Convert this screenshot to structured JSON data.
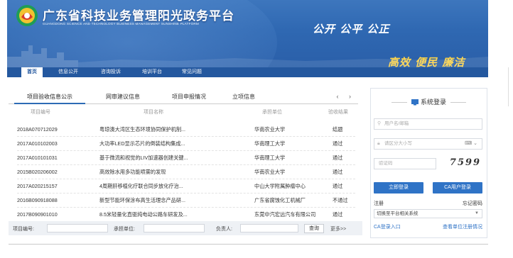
{
  "header": {
    "title": "广东省科技业务管理阳光政务平台",
    "subtitle": "GUANGDONG SCIENCE AND TECHNOLOGY BUSINESS MANAGEMENT SUNSHINE PLATFORM",
    "slogan1": "公开 公平 公正",
    "slogan2": "高效 便民 廉洁"
  },
  "nav": {
    "items": [
      {
        "label": "首页"
      },
      {
        "label": "信息公开"
      },
      {
        "label": "咨询投诉"
      },
      {
        "label": "培训平台"
      },
      {
        "label": "常见问题"
      }
    ]
  },
  "tabs": {
    "items": [
      {
        "label": "项目验收信息公示"
      },
      {
        "label": "网审建议信息"
      },
      {
        "label": "项目申报情况"
      },
      {
        "label": "立项信息"
      }
    ],
    "arrows": "‹ ›"
  },
  "table": {
    "headers": [
      "项目编号",
      "项目名称",
      "承担单位",
      "验收结果"
    ],
    "rows": [
      [
        "2018A070712029",
        "粤琼澳大湾区生态环境协同保护机制...",
        "华南农业大学",
        "结题"
      ],
      [
        "2017A010102003",
        "大功率LED显示芯片的倒装结构集成...",
        "华南理工大学",
        "通过"
      ],
      [
        "2017A010101031",
        "基于微流和视觉的LIV加速器创建关键...",
        "华南理工大学",
        "通过"
      ],
      [
        "2015B020206002",
        "高效除水用多功能喷雾的发现",
        "华南农业大学",
        "通过"
      ],
      [
        "2017A020215157",
        "4周期肝移植化疗联合同步放化疗治...",
        "中山大学附属肿瘤中心",
        "通过"
      ],
      [
        "2016B090918088",
        "新型节能环保涂布高生活理念产品研...",
        "广东省腐蚀化工机械厂",
        "不通过"
      ],
      [
        "2017B090901010",
        "8.5米轻量化直驱纯电动公路车研发及...",
        "东莞中汽宏远汽车有限公司",
        "通过"
      ]
    ]
  },
  "search": {
    "project_no_label": "项目编号:",
    "unit_label": "承担单位:",
    "person_label": "负责人:",
    "search_button": "查询",
    "more_link": "更多>>"
  },
  "login": {
    "heading": "系统登录",
    "username_placeholder": "用户名/邮箱",
    "password_placeholder": "请区分大小写",
    "captcha_placeholder": "验证码",
    "captcha_text": "7599",
    "login_button": "立即登录",
    "ca_button": "CA用户登录",
    "register_link": "注册",
    "forgot_link": "忘记密码",
    "switch_select": "切换至平台相关系统",
    "ca_entry_link": "CA登录入口",
    "unit_query_link": "查看单位注册情况"
  },
  "colors": {
    "banner_blue": "#2f68b2",
    "nav_blue": "#24589f",
    "button_blue": "#2f73c6",
    "slogan_gold": "#ffd54a"
  }
}
